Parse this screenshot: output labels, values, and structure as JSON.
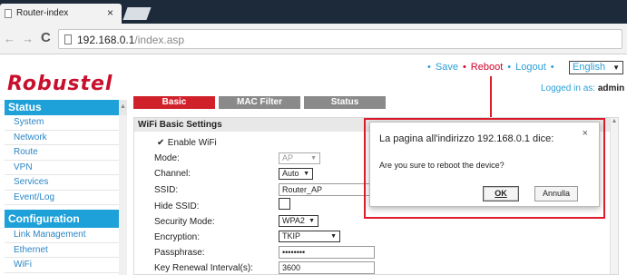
{
  "browser": {
    "tab_title": "Router-index",
    "tab_close": "×",
    "url_host": "192.168.0.1",
    "url_path": "/index.asp",
    "back_icon": "arrow-left-icon",
    "forward_icon": "arrow-right-icon",
    "reload_icon": "reload-icon",
    "reload_glyph": "C"
  },
  "header": {
    "logo": "Robustel",
    "nav": {
      "save": "Save",
      "reboot": "Reboot",
      "logout": "Logout",
      "bullet": "•"
    },
    "language": "English",
    "logged_in_label": "Logged in as:",
    "logged_in_user": "admin"
  },
  "sidebar": {
    "status_heading": "Status",
    "status_items": [
      "System",
      "Network",
      "Route",
      "VPN",
      "Services",
      "Event/Log"
    ],
    "config_heading": "Configuration",
    "config_items": [
      "Link Management",
      "Ethernet",
      "WiFi"
    ]
  },
  "tabs": {
    "basic": "Basic",
    "mac_filter": "MAC Filter",
    "status": "Status"
  },
  "form": {
    "title": "WiFi Basic Settings",
    "enable_wifi": "Enable WiFi",
    "enable_checked": "✔",
    "mode_label": "Mode:",
    "mode_value": "AP",
    "channel_label": "Channel:",
    "channel_value": "Auto",
    "ssid_label": "SSID:",
    "ssid_value": "Router_AP",
    "hide_ssid_label": "Hide SSID:",
    "security_label": "Security Mode:",
    "security_value": "WPA2",
    "encryption_label": "Encryption:",
    "encryption_value": "TKIP",
    "passphrase_label": "Passphrase:",
    "passphrase_value": "••••••••",
    "rekey_label": "Key Renewal Interval(s):",
    "rekey_value": "3600"
  },
  "dialog": {
    "title": "La pagina all'indirizzo 192.168.0.1 dice:",
    "message": "Are you sure to reboot the device?",
    "ok": "OK",
    "cancel": "Annulla",
    "close": "×"
  },
  "colors": {
    "accent_blue": "#1ea0d9",
    "brand_red": "#c8102e",
    "highlight_red": "#e01b2b"
  }
}
